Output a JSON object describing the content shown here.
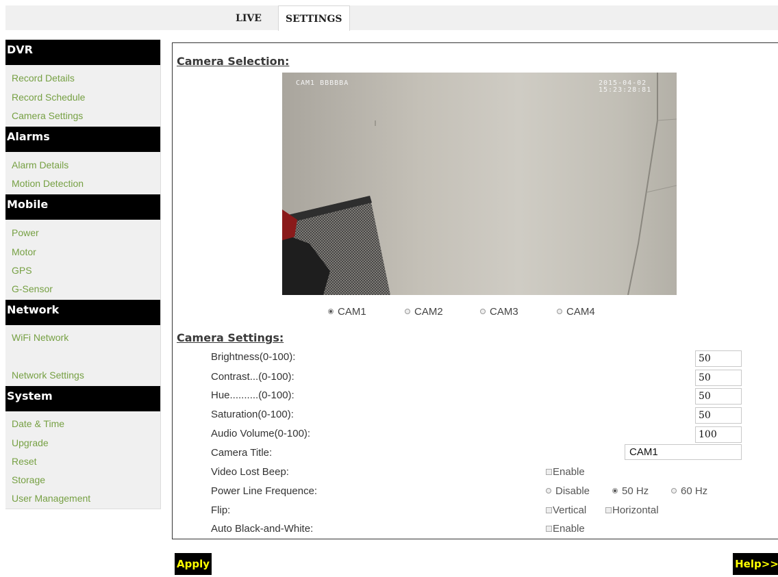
{
  "tabs": [
    "LIVE",
    "SETTINGS"
  ],
  "sidebar": {
    "sections": [
      {
        "title": "DVR",
        "items": [
          "Record Details",
          "Record Schedule",
          "Camera Settings"
        ]
      },
      {
        "title": "Alarms",
        "items": [
          "Alarm Details",
          "Motion Detection"
        ]
      },
      {
        "title": "Mobile",
        "items": [
          "Power",
          "Motor",
          "GPS",
          "G-Sensor"
        ]
      },
      {
        "title": "Network",
        "items": [
          "WiFi Network",
          "Network Settings"
        ]
      },
      {
        "title": "System",
        "items": [
          "Date & Time",
          "Upgrade",
          "Reset",
          "Storage",
          "User Management"
        ]
      }
    ]
  },
  "camera_selection": {
    "title": "Camera Selection:",
    "osd_name": "CAM1 BBBBBA",
    "osd_date": "2015-04-02",
    "osd_time": "15:23:28:81",
    "options": [
      "CAM1",
      "CAM2",
      "CAM3",
      "CAM4"
    ],
    "selected": "CAM1"
  },
  "camera_settings": {
    "title": "Camera Settings:",
    "brightness_label": "Brightness(0-100):",
    "brightness": "50",
    "contrast_label": "Contrast...(0-100):",
    "contrast": "50",
    "hue_label": "Hue..........(0-100):",
    "hue": "50",
    "saturation_label": "Saturation(0-100):",
    "saturation": "50",
    "audio_label": "Audio Volume(0-100):",
    "audio": "100",
    "camera_title_label": "Camera Title:",
    "camera_title": "CAM1",
    "video_lost_label": "Video Lost Beep:",
    "enable_label": "Enable",
    "power_line_label": "Power Line Frequence:",
    "power_line_options": [
      "Disable",
      "50 Hz",
      "60 Hz"
    ],
    "power_line_selected": "50 Hz",
    "flip_label": "Flip:",
    "vertical_label": "Vertical",
    "horizontal_label": "Horizontal",
    "auto_bw_label": "Auto Black-and-White:"
  },
  "buttons": {
    "apply": "Apply",
    "help": "Help>>"
  },
  "colors": {
    "link": "#76a043",
    "button_text": "#ffff00",
    "section_bg": "#000000"
  }
}
